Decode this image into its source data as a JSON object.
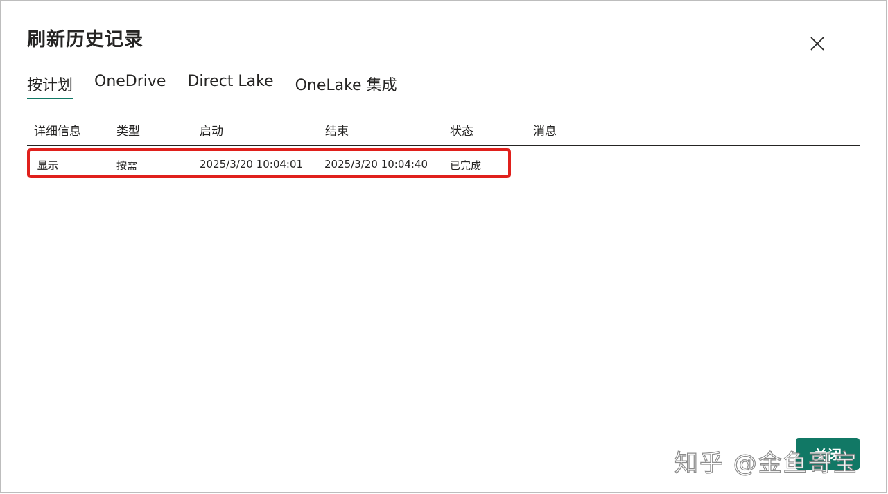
{
  "dialog": {
    "title": "刷新历史记录",
    "close_icon": "close-icon"
  },
  "tabs": [
    {
      "label": "按计划",
      "active": true
    },
    {
      "label": "OneDrive",
      "active": false
    },
    {
      "label": "Direct Lake",
      "active": false
    },
    {
      "label": "OneLake 集成",
      "active": false
    }
  ],
  "table": {
    "columns": [
      "详细信息",
      "类型",
      "启动",
      "结束",
      "状态",
      "消息"
    ],
    "rows": [
      {
        "details": "显示",
        "type": "按需",
        "start": "2025/3/20 10:04:01",
        "end": "2025/3/20 10:04:40",
        "status": "已完成",
        "message": ""
      }
    ]
  },
  "footer": {
    "ok_label": "关闭"
  },
  "watermark": "知乎 @金鱼哥宝",
  "colors": {
    "accent": "#117865",
    "highlight": "#e0201c"
  }
}
